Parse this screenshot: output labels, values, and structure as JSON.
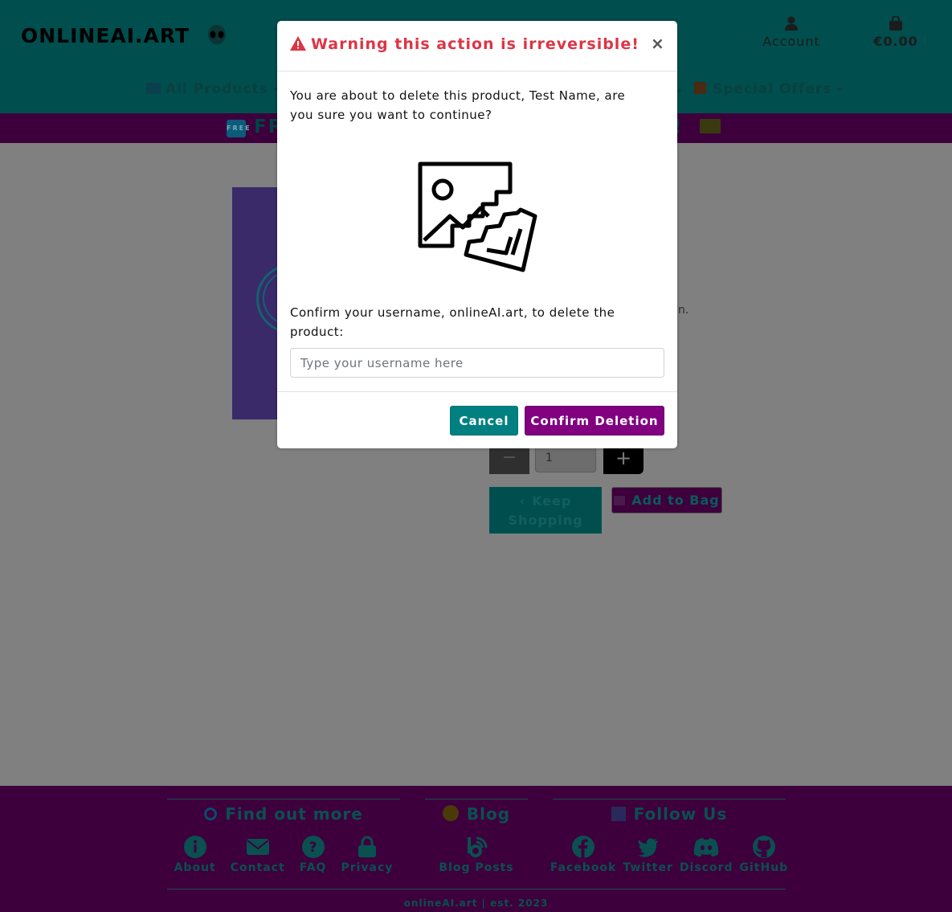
{
  "header": {
    "logo": "ONLINEAI.ART",
    "account_label": "Account",
    "bag_total": "€0.00"
  },
  "nav": {
    "all_products": "All Products",
    "special_offers": "Special Offers"
  },
  "banner": {
    "badge": "FREE",
    "left_text": "FR",
    "right_text": "0!"
  },
  "background": {
    "description_fragment": "n.",
    "quantity": "1",
    "keep_shopping": "Keep Shopping",
    "add_to_bag": "Add to Bag"
  },
  "modal": {
    "title": "Warning this action is irreversible!",
    "close": "×",
    "message": "You are about to delete this product, Test Name, are you sure you want to continue?",
    "confirm_label": "Confirm your username, onlineAI.art, to delete the product:",
    "input_placeholder": "Type your username here",
    "input_value": "",
    "cancel": "Cancel",
    "confirm": "Confirm Deletion",
    "title_color": "#dc3545",
    "cancel_color": "#008080",
    "confirm_color": "#800080"
  },
  "footer": {
    "find_out_more": {
      "title": "Find out more",
      "links": [
        "About",
        "Contact",
        "FAQ",
        "Privacy"
      ]
    },
    "blog": {
      "title": "Blog",
      "links": [
        "Blog Posts"
      ]
    },
    "follow_us": {
      "title": "Follow Us",
      "links": [
        "Facebook",
        "Twitter",
        "Discord",
        "GitHub"
      ]
    },
    "copyright": "onlineAI.art | est. 2023"
  }
}
